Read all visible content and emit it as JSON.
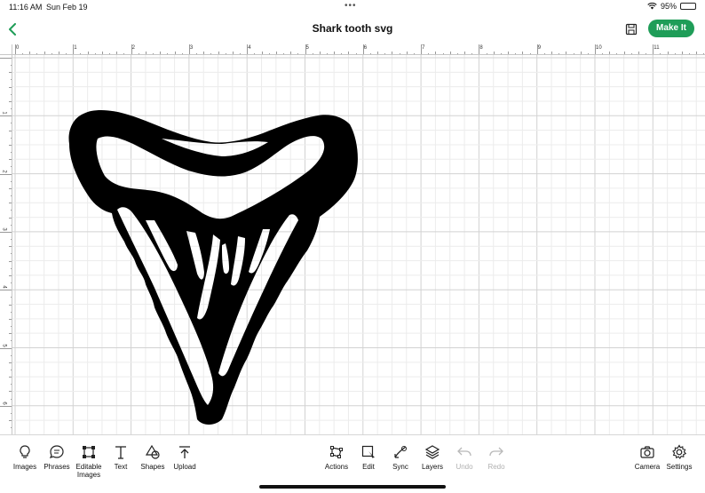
{
  "status_bar": {
    "time": "11:16 AM",
    "date": "Sun Feb 19",
    "battery_percent": "95%",
    "battery_level": 0.95
  },
  "header": {
    "back_icon": "chevron-left-icon",
    "title": "Shark tooth svg",
    "save_icon": "save-icon",
    "make_it_label": "Make It",
    "accent_color": "#1f9d58"
  },
  "rulers": {
    "top_labels": [
      "0",
      "1",
      "2",
      "3",
      "4",
      "5",
      "6",
      "7",
      "8",
      "9",
      "10",
      "11"
    ],
    "left_labels": [
      "1",
      "2",
      "3",
      "4",
      "5",
      "6",
      "7"
    ]
  },
  "canvas": {
    "object": "shark-tooth-svg",
    "fill_color": "#000000"
  },
  "toolbar": {
    "left_tools": [
      {
        "label": "Images",
        "icon": "lightbulb-icon"
      },
      {
        "label": "Phrases",
        "icon": "speech-bubble-icon"
      },
      {
        "label": "Editable Images",
        "icon": "editable-images-icon"
      },
      {
        "label": "Text",
        "icon": "text-icon"
      },
      {
        "label": "Shapes",
        "icon": "shapes-icon"
      },
      {
        "label": "Upload",
        "icon": "upload-icon"
      }
    ],
    "center_tools": [
      {
        "label": "Actions",
        "icon": "actions-icon",
        "enabled": true
      },
      {
        "label": "Edit",
        "icon": "edit-icon",
        "enabled": true
      },
      {
        "label": "Sync",
        "icon": "sync-icon",
        "enabled": true
      },
      {
        "label": "Layers",
        "icon": "layers-icon",
        "enabled": true
      },
      {
        "label": "Undo",
        "icon": "undo-icon",
        "enabled": false
      },
      {
        "label": "Redo",
        "icon": "redo-icon",
        "enabled": false
      }
    ],
    "right_tools": [
      {
        "label": "Camera",
        "icon": "camera-icon"
      },
      {
        "label": "Settings",
        "icon": "gear-icon"
      }
    ]
  }
}
